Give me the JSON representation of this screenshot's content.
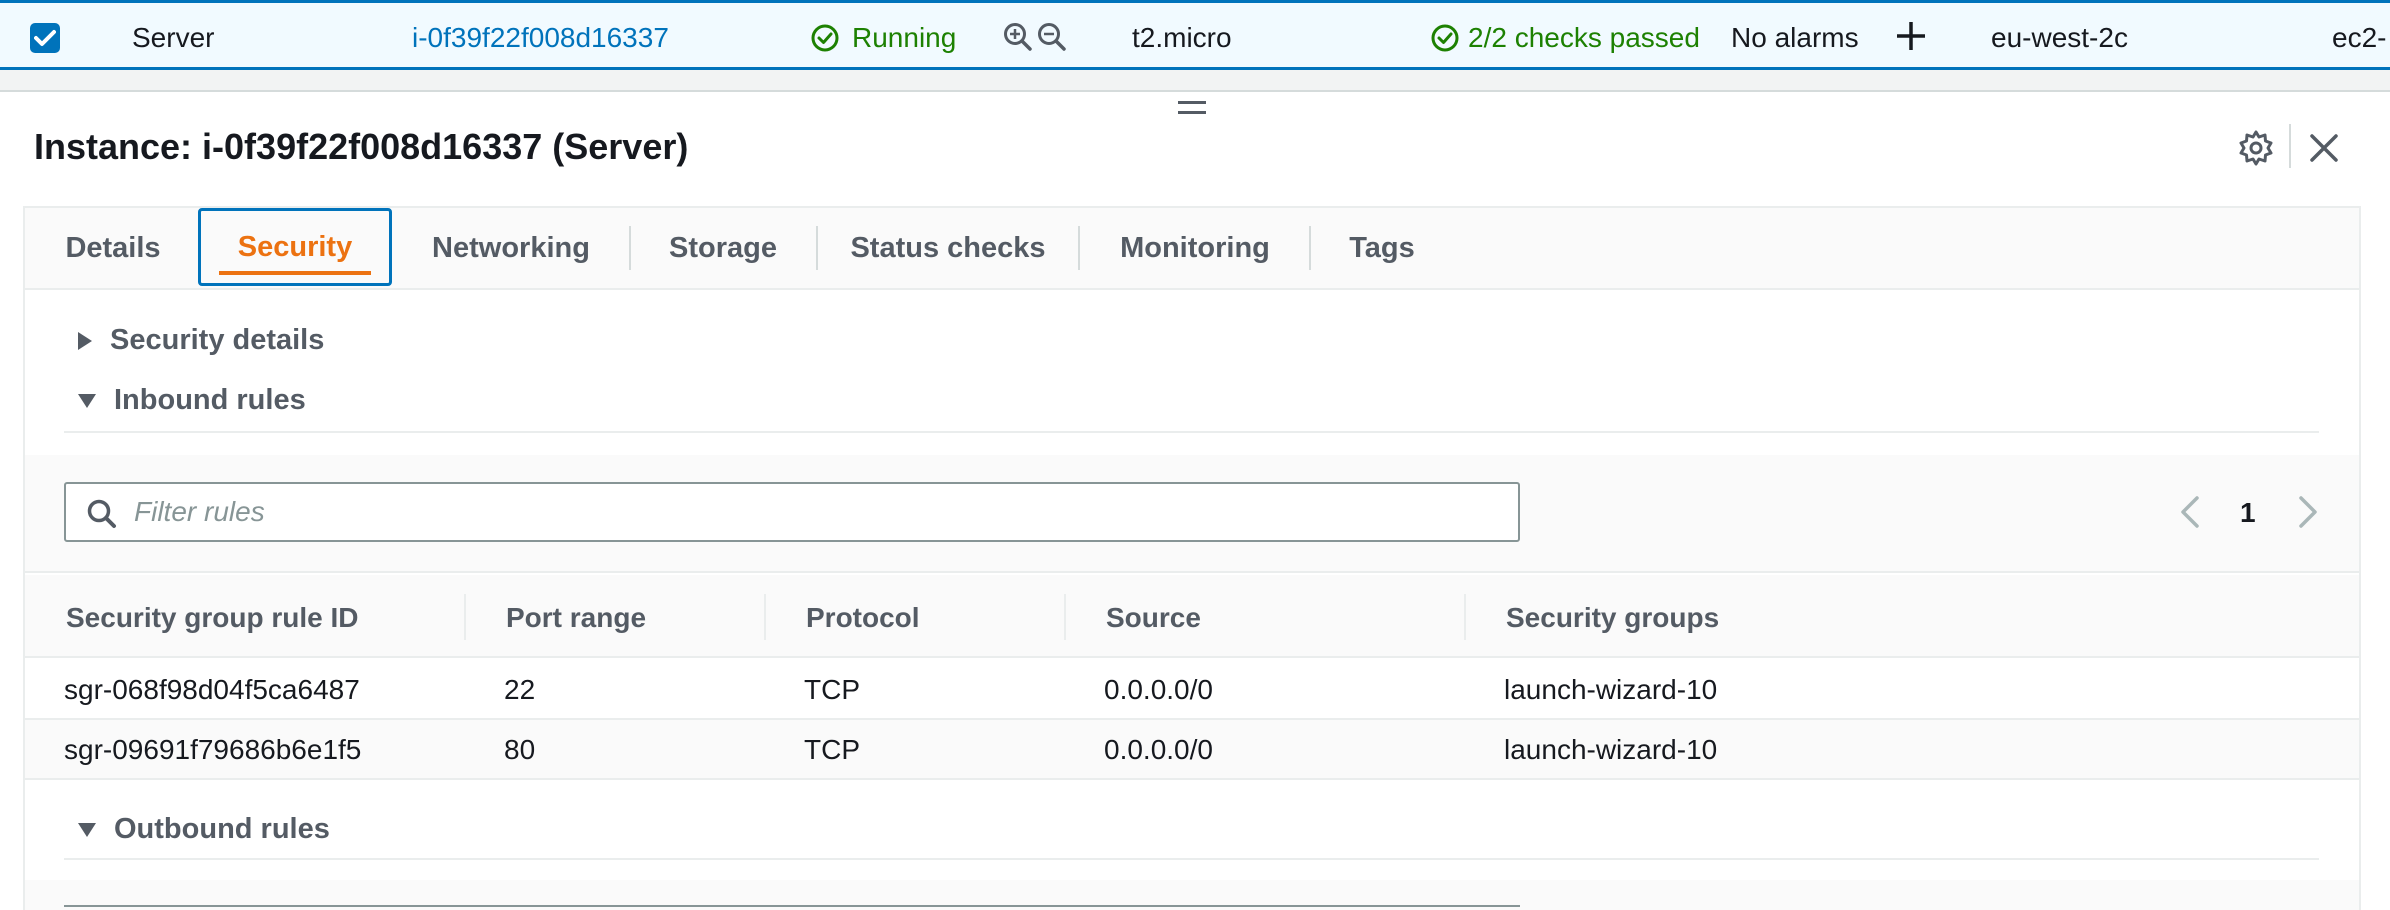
{
  "instance_row": {
    "checked": true,
    "name": "Server",
    "instance_id": "i-0f39f22f008d16337",
    "state": "Running",
    "instance_type": "t2.micro",
    "status_check": "2/2 checks passed",
    "alarm_status": "No alarms",
    "availability_zone": "eu-west-2c",
    "public_dns": "ec2-"
  },
  "panel": {
    "title": "Instance: i-0f39f22f008d16337 (Server)"
  },
  "tabs": [
    {
      "label": "Details",
      "active": false
    },
    {
      "label": "Security",
      "active": true
    },
    {
      "label": "Networking",
      "active": false
    },
    {
      "label": "Storage",
      "active": false
    },
    {
      "label": "Status checks",
      "active": false
    },
    {
      "label": "Monitoring",
      "active": false
    },
    {
      "label": "Tags",
      "active": false
    }
  ],
  "sections": {
    "security_details": {
      "label": "Security details",
      "expanded": false
    },
    "inbound_rules": {
      "label": "Inbound rules",
      "expanded": true
    },
    "outbound_rules": {
      "label": "Outbound rules",
      "expanded": true
    }
  },
  "filter": {
    "placeholder": "Filter rules",
    "value": ""
  },
  "pagination": {
    "current_page": "1"
  },
  "inbound_table": {
    "columns": [
      "Security group rule ID",
      "Port range",
      "Protocol",
      "Source",
      "Security groups"
    ],
    "rows": [
      [
        "sgr-068f98d04f5ca6487",
        "22",
        "TCP",
        "0.0.0.0/0",
        "launch-wizard-10"
      ],
      [
        "sgr-09691f79686b6e1f5",
        "80",
        "TCP",
        "0.0.0.0/0",
        "launch-wizard-10"
      ]
    ]
  },
  "colors": {
    "link": "#0073bb",
    "success": "#1d8102",
    "active_tab": "#ec7211",
    "text_secondary": "#545b64"
  }
}
